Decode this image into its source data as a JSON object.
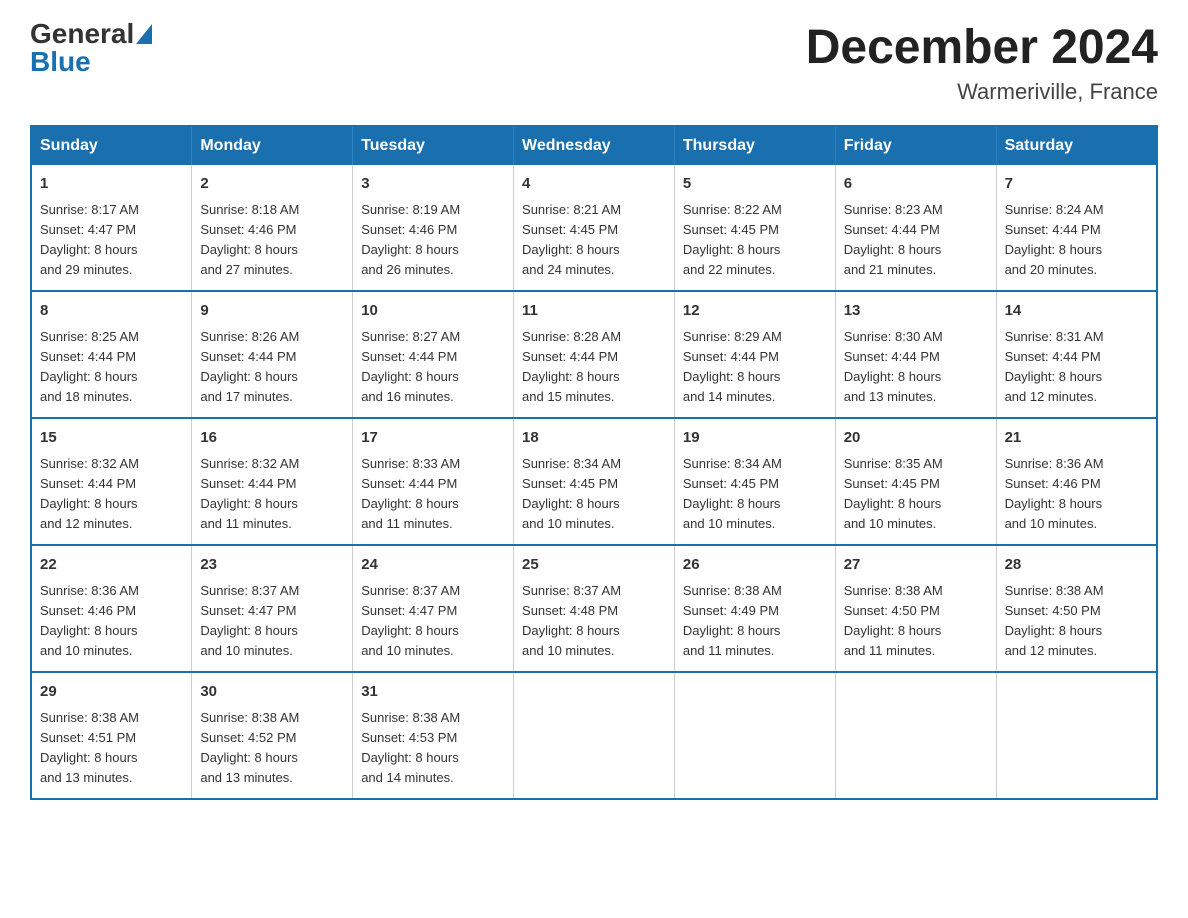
{
  "logo": {
    "general": "General",
    "blue": "Blue"
  },
  "title": "December 2024",
  "subtitle": "Warmeriville, France",
  "days_of_week": [
    "Sunday",
    "Monday",
    "Tuesday",
    "Wednesday",
    "Thursday",
    "Friday",
    "Saturday"
  ],
  "weeks": [
    [
      {
        "day": "1",
        "sunrise": "8:17 AM",
        "sunset": "4:47 PM",
        "daylight": "8 hours and 29 minutes."
      },
      {
        "day": "2",
        "sunrise": "8:18 AM",
        "sunset": "4:46 PM",
        "daylight": "8 hours and 27 minutes."
      },
      {
        "day": "3",
        "sunrise": "8:19 AM",
        "sunset": "4:46 PM",
        "daylight": "8 hours and 26 minutes."
      },
      {
        "day": "4",
        "sunrise": "8:21 AM",
        "sunset": "4:45 PM",
        "daylight": "8 hours and 24 minutes."
      },
      {
        "day": "5",
        "sunrise": "8:22 AM",
        "sunset": "4:45 PM",
        "daylight": "8 hours and 22 minutes."
      },
      {
        "day": "6",
        "sunrise": "8:23 AM",
        "sunset": "4:44 PM",
        "daylight": "8 hours and 21 minutes."
      },
      {
        "day": "7",
        "sunrise": "8:24 AM",
        "sunset": "4:44 PM",
        "daylight": "8 hours and 20 minutes."
      }
    ],
    [
      {
        "day": "8",
        "sunrise": "8:25 AM",
        "sunset": "4:44 PM",
        "daylight": "8 hours and 18 minutes."
      },
      {
        "day": "9",
        "sunrise": "8:26 AM",
        "sunset": "4:44 PM",
        "daylight": "8 hours and 17 minutes."
      },
      {
        "day": "10",
        "sunrise": "8:27 AM",
        "sunset": "4:44 PM",
        "daylight": "8 hours and 16 minutes."
      },
      {
        "day": "11",
        "sunrise": "8:28 AM",
        "sunset": "4:44 PM",
        "daylight": "8 hours and 15 minutes."
      },
      {
        "day": "12",
        "sunrise": "8:29 AM",
        "sunset": "4:44 PM",
        "daylight": "8 hours and 14 minutes."
      },
      {
        "day": "13",
        "sunrise": "8:30 AM",
        "sunset": "4:44 PM",
        "daylight": "8 hours and 13 minutes."
      },
      {
        "day": "14",
        "sunrise": "8:31 AM",
        "sunset": "4:44 PM",
        "daylight": "8 hours and 12 minutes."
      }
    ],
    [
      {
        "day": "15",
        "sunrise": "8:32 AM",
        "sunset": "4:44 PM",
        "daylight": "8 hours and 12 minutes."
      },
      {
        "day": "16",
        "sunrise": "8:32 AM",
        "sunset": "4:44 PM",
        "daylight": "8 hours and 11 minutes."
      },
      {
        "day": "17",
        "sunrise": "8:33 AM",
        "sunset": "4:44 PM",
        "daylight": "8 hours and 11 minutes."
      },
      {
        "day": "18",
        "sunrise": "8:34 AM",
        "sunset": "4:45 PM",
        "daylight": "8 hours and 10 minutes."
      },
      {
        "day": "19",
        "sunrise": "8:34 AM",
        "sunset": "4:45 PM",
        "daylight": "8 hours and 10 minutes."
      },
      {
        "day": "20",
        "sunrise": "8:35 AM",
        "sunset": "4:45 PM",
        "daylight": "8 hours and 10 minutes."
      },
      {
        "day": "21",
        "sunrise": "8:36 AM",
        "sunset": "4:46 PM",
        "daylight": "8 hours and 10 minutes."
      }
    ],
    [
      {
        "day": "22",
        "sunrise": "8:36 AM",
        "sunset": "4:46 PM",
        "daylight": "8 hours and 10 minutes."
      },
      {
        "day": "23",
        "sunrise": "8:37 AM",
        "sunset": "4:47 PM",
        "daylight": "8 hours and 10 minutes."
      },
      {
        "day": "24",
        "sunrise": "8:37 AM",
        "sunset": "4:47 PM",
        "daylight": "8 hours and 10 minutes."
      },
      {
        "day": "25",
        "sunrise": "8:37 AM",
        "sunset": "4:48 PM",
        "daylight": "8 hours and 10 minutes."
      },
      {
        "day": "26",
        "sunrise": "8:38 AM",
        "sunset": "4:49 PM",
        "daylight": "8 hours and 11 minutes."
      },
      {
        "day": "27",
        "sunrise": "8:38 AM",
        "sunset": "4:50 PM",
        "daylight": "8 hours and 11 minutes."
      },
      {
        "day": "28",
        "sunrise": "8:38 AM",
        "sunset": "4:50 PM",
        "daylight": "8 hours and 12 minutes."
      }
    ],
    [
      {
        "day": "29",
        "sunrise": "8:38 AM",
        "sunset": "4:51 PM",
        "daylight": "8 hours and 13 minutes."
      },
      {
        "day": "30",
        "sunrise": "8:38 AM",
        "sunset": "4:52 PM",
        "daylight": "8 hours and 13 minutes."
      },
      {
        "day": "31",
        "sunrise": "8:38 AM",
        "sunset": "4:53 PM",
        "daylight": "8 hours and 14 minutes."
      },
      null,
      null,
      null,
      null
    ]
  ],
  "labels": {
    "sunrise": "Sunrise:",
    "sunset": "Sunset:",
    "daylight": "Daylight:"
  }
}
